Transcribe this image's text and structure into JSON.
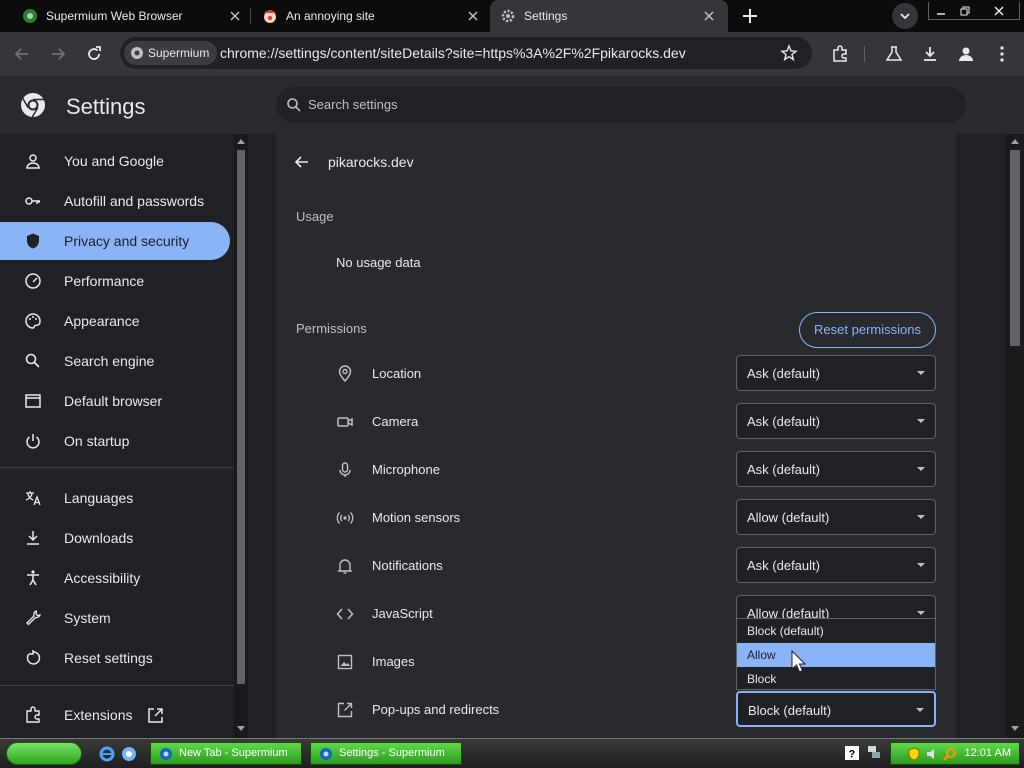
{
  "browser": {
    "tabs": [
      {
        "title": "Supermium Web Browser",
        "active": false
      },
      {
        "title": "An annoying site",
        "active": false
      },
      {
        "title": "Settings",
        "active": true
      }
    ],
    "chip_label": "Supermium",
    "url": "chrome://settings/content/siteDetails?site=https%3A%2F%2Fpikarocks.dev"
  },
  "settings": {
    "title": "Settings",
    "search_placeholder": "Search settings"
  },
  "sidebar": {
    "items": [
      {
        "label": "You and Google",
        "icon": "person-icon"
      },
      {
        "label": "Autofill and passwords",
        "icon": "key-icon"
      },
      {
        "label": "Privacy and security",
        "icon": "shield-icon",
        "selected": true
      },
      {
        "label": "Performance",
        "icon": "speedometer-icon"
      },
      {
        "label": "Appearance",
        "icon": "palette-icon"
      },
      {
        "label": "Search engine",
        "icon": "search-icon"
      },
      {
        "label": "Default browser",
        "icon": "browser-window-icon"
      },
      {
        "label": "On startup",
        "icon": "power-icon"
      },
      {
        "label": "Languages",
        "icon": "translate-icon"
      },
      {
        "label": "Downloads",
        "icon": "download-icon"
      },
      {
        "label": "Accessibility",
        "icon": "accessibility-icon"
      },
      {
        "label": "System",
        "icon": "wrench-icon"
      },
      {
        "label": "Reset settings",
        "icon": "reset-icon"
      },
      {
        "label": "Extensions",
        "icon": "puzzle-icon"
      }
    ]
  },
  "site": {
    "name": "pikarocks.dev",
    "usage_heading": "Usage",
    "usage_value": "No usage data",
    "permissions_heading": "Permissions",
    "reset_label": "Reset permissions",
    "permissions": [
      {
        "label": "Location",
        "value": "Ask (default)",
        "icon": "location-pin-icon"
      },
      {
        "label": "Camera",
        "value": "Ask (default)",
        "icon": "camera-icon"
      },
      {
        "label": "Microphone",
        "value": "Ask (default)",
        "icon": "microphone-icon"
      },
      {
        "label": "Motion sensors",
        "value": "Allow (default)",
        "icon": "motion-sensor-icon"
      },
      {
        "label": "Notifications",
        "value": "Ask (default)",
        "icon": "bell-icon"
      },
      {
        "label": "JavaScript",
        "value": "Allow (default)",
        "icon": "code-icon"
      },
      {
        "label": "Images",
        "value": "",
        "icon": "image-icon"
      },
      {
        "label": "Pop-ups and redirects",
        "value": "Block (default)",
        "icon": "open-external-icon"
      }
    ],
    "dropdown_options": [
      "Block (default)",
      "Allow",
      "Block"
    ],
    "dropdown_hover_index": 1
  },
  "taskbar": {
    "windows": [
      {
        "label": "New Tab - Supermium"
      },
      {
        "label": "Settings - Supermium"
      }
    ],
    "clock": "12:01 AM"
  },
  "colors": {
    "accent": "#8ab4f8",
    "background": "#202124",
    "card": "#292a2d",
    "taskbar_green": "#3cb62a"
  }
}
